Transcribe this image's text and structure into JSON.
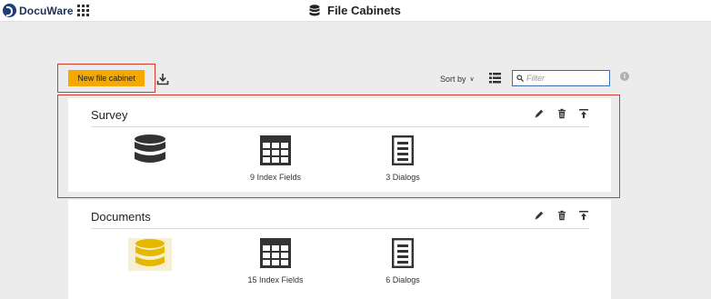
{
  "app": {
    "brand": "DocuWare",
    "title": "File Cabinets"
  },
  "toolbar": {
    "new_button": "New file cabinet",
    "sort_label": "Sort by",
    "filter_placeholder": "Filter",
    "info_glyph": "i"
  },
  "icons": {
    "logo": "docuware-logo-icon",
    "apps": "app-grid-icon",
    "title": "database-icon",
    "download": "download-icon",
    "sort_dropdown": "chevron-down-icon",
    "list_view": "list-view-icon",
    "search": "search-icon",
    "info": "info-icon",
    "edit": "pencil-icon",
    "delete": "trash-icon",
    "export": "export-icon",
    "index_fields": "table-icon",
    "dialogs": "document-list-icon"
  },
  "colors": {
    "accent": "#f5a800",
    "highlight": "#d53b2f",
    "brand": "#1f3d7a",
    "cabinet_dark": "#333333",
    "cabinet_yellow": "#e5b800",
    "filter_border": "#3b6fb6"
  },
  "cabinets": [
    {
      "name": "Survey",
      "index_fields": "9 Index Fields",
      "dialogs": "3 Dialogs",
      "color": "#333333"
    },
    {
      "name": "Documents",
      "index_fields": "15 Index Fields",
      "dialogs": "6 Dialogs",
      "color": "#e5b800"
    }
  ]
}
